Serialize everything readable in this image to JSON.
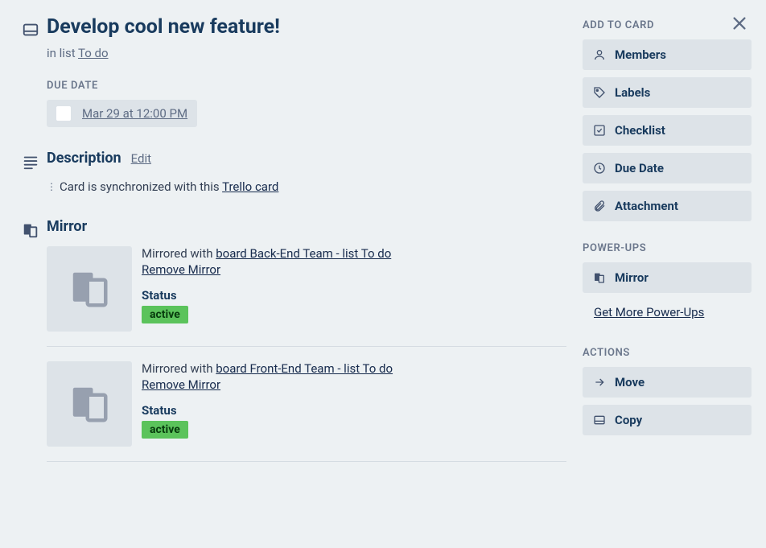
{
  "card": {
    "title": "Develop cool new feature!",
    "inlist_prefix": "in list ",
    "inlist_name": "To do"
  },
  "due": {
    "label": "DUE DATE",
    "text": "Mar 29 at 12:00 PM"
  },
  "description": {
    "heading": "Description",
    "edit": "Edit",
    "prefix": "Card is synchronized with this ",
    "link": "Trello card"
  },
  "mirror": {
    "heading": "Mirror",
    "status_label": "Status",
    "remove_label": "Remove Mirror",
    "prefix": "Mirrored with ",
    "items": [
      {
        "target": "board Back-End Team - list To do",
        "status": "active"
      },
      {
        "target": "board Front-End Team - list To do",
        "status": "active"
      }
    ]
  },
  "sidebar": {
    "add_heading": "ADD TO CARD",
    "add": {
      "members": "Members",
      "labels": "Labels",
      "checklist": "Checklist",
      "duedate": "Due Date",
      "attachment": "Attachment"
    },
    "powerups_heading": "POWER-UPS",
    "powerups": {
      "mirror": "Mirror"
    },
    "get_more": "Get More Power-Ups",
    "actions_heading": "ACTIONS",
    "actions": {
      "move": "Move",
      "copy": "Copy"
    }
  }
}
